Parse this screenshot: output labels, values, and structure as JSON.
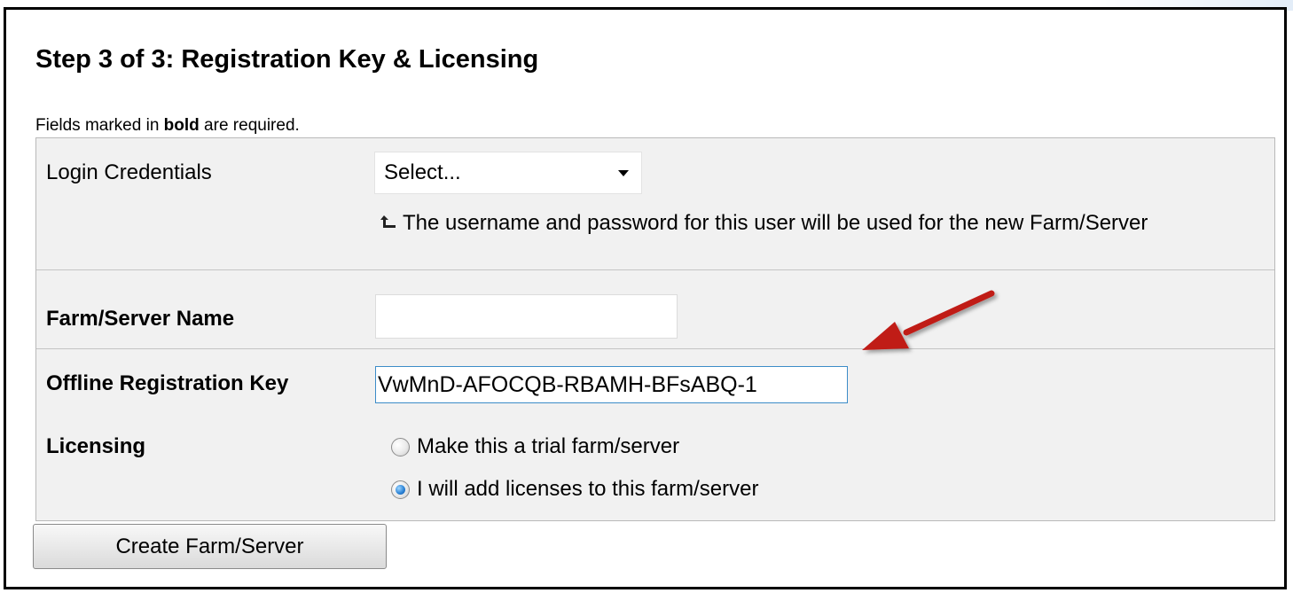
{
  "page": {
    "title": "Step 3 of 3: Registration Key & Licensing",
    "required_note": {
      "prefix": "Fields marked in ",
      "bold_word": "bold",
      "suffix": " are required."
    }
  },
  "form": {
    "login_credentials": {
      "label": "Login Credentials",
      "selected": "Select...",
      "hint": "The username and password for this user will be used for the new Farm/Server"
    },
    "farm_server_name": {
      "label": "Farm/Server Name",
      "value": ""
    },
    "offline_registration_key": {
      "label": "Offline Registration Key",
      "value": "VwMnD-AFOCQB-RBAMH-BFsABQ-1"
    },
    "licensing": {
      "label": "Licensing",
      "options": [
        {
          "label": "Make this a trial farm/server",
          "checked": false
        },
        {
          "label": "I will add licenses to this farm/server",
          "checked": true
        }
      ]
    }
  },
  "actions": {
    "create_label": "Create Farm/Server"
  },
  "annotation": {
    "arrow_color": "#c01a17",
    "arrow_target": "offline-registration-key-input"
  }
}
